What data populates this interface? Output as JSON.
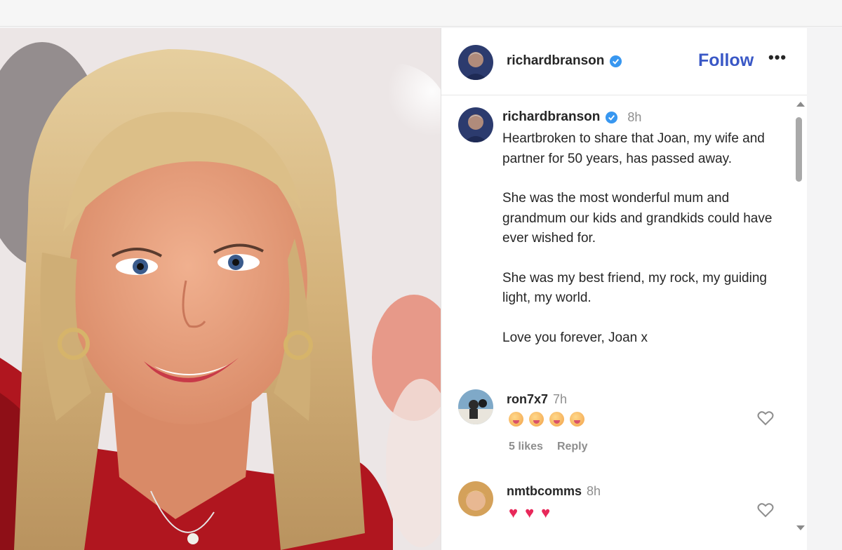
{
  "post": {
    "photo_alt": "",
    "author": {
      "username": "richardbranson",
      "verified_icon": "verified-badge-icon",
      "follow_label": "Follow",
      "more_label": "•••"
    },
    "caption": {
      "username": "richardbranson",
      "time": "8h",
      "paragraphs": [
        "Heartbroken to share that Joan, my wife and partner for 50 years, has passed away.",
        "She was the most wonderful mum and grandmum our kids and grandkids could have ever wished for.",
        "She was my best friend, my rock, my guiding light, my world.",
        "Love you forever, Joan x"
      ]
    },
    "comments": [
      {
        "username": "ron7x7",
        "time": "7h",
        "reaction": "4 pleading-face emojis",
        "likes": "5 likes",
        "reply_label": "Reply"
      },
      {
        "username": "nmtbcomms",
        "time": "8h",
        "reaction": "3 red hearts"
      }
    ]
  },
  "colors": {
    "follow": "#3a58c6",
    "verified": "#3897f0",
    "muted": "#8e8e8e",
    "heart": "#e8285a"
  }
}
